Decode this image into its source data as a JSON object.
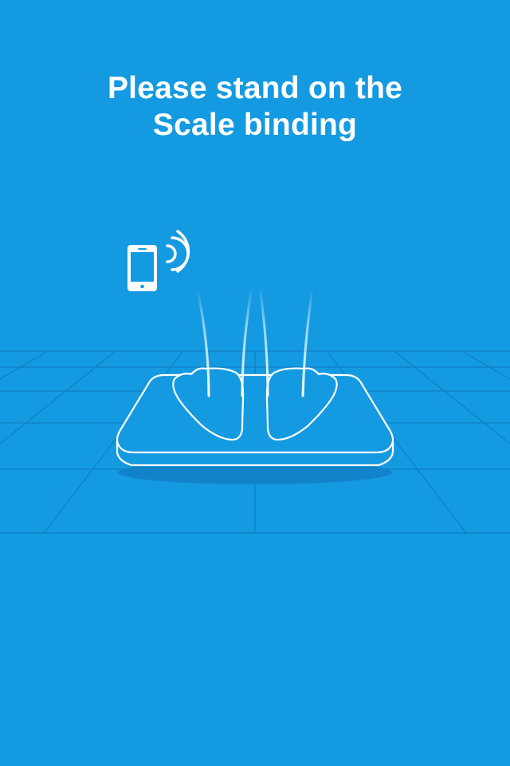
{
  "screen": {
    "background_color": "#149ae1",
    "line_color": "#ffffff",
    "grid_color": "#0f7fc4",
    "title_lines": [
      "Please stand on the",
      "Scale binding"
    ]
  },
  "illustration": {
    "icons": [
      "smartphone-icon",
      "wireless-signal-icon",
      "bathroom-scale-icon",
      "feet-icon",
      "floor-grid"
    ]
  }
}
